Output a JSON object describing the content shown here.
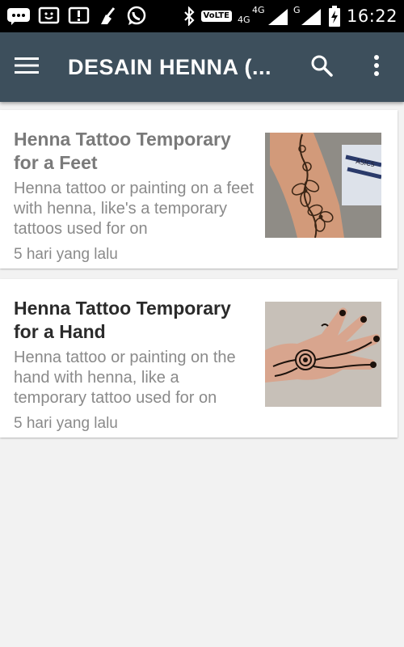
{
  "status_bar": {
    "time": "16:22",
    "volte": "VoLTE",
    "net1": "4G",
    "net2": "4G",
    "net3": "G",
    "icons": [
      "chat-bubble-icon",
      "sms-smiley-icon",
      "alert-icon",
      "broom-icon",
      "whatsapp-icon",
      "bluetooth-icon",
      "signal-icon",
      "battery-charging-icon"
    ]
  },
  "app_bar": {
    "title": "DESAIN HENNA (...",
    "menu_icon": "hamburger-menu-icon",
    "search_icon": "search-icon",
    "more_icon": "more-vert-icon",
    "color": "#3d4f5c"
  },
  "articles": [
    {
      "title": "Henna Tattoo Temporary for a Feet",
      "description": "Henna tattoo or painting on a feet with henna, like's a temporary tattoos used for on",
      "time": "5 hari yang lalu",
      "image": "henna-leg-photo",
      "read": true
    },
    {
      "title": "Henna Tattoo Temporary for a Hand",
      "description": "Henna tattoo or painting on the hand with henna, like a temporary tattoo used for on",
      "time": "5 hari yang lalu",
      "image": "henna-hand-photo",
      "read": false
    }
  ]
}
